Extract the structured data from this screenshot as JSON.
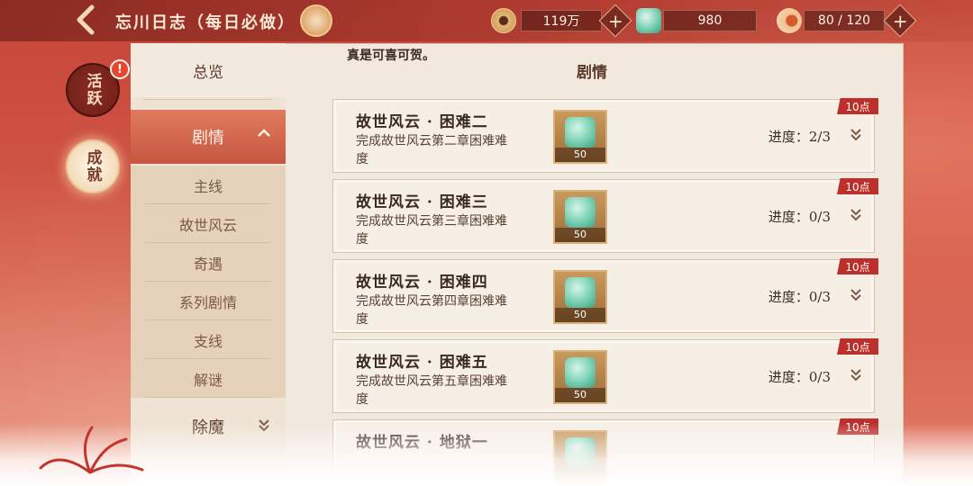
{
  "header": {
    "title": "忘川日志（每日必做）",
    "currency": "119万",
    "jade": "980",
    "stamina": "80 / 120"
  },
  "side_tabs": {
    "active_label": "活跃",
    "achieve_label": "成就",
    "alert": "!"
  },
  "banner_text": "真是可喜可贺。",
  "nav": {
    "overview": "总览",
    "story": "剧情",
    "sub_items": [
      "主线",
      "故世风云",
      "奇遇",
      "系列剧情",
      "支线",
      "解谜"
    ],
    "exorcise": "除魔"
  },
  "section_title": "剧情",
  "quests": [
    {
      "title": "故世风云 · 困难二",
      "desc": "完成故世风云第二章困难难度",
      "reward": "50",
      "progress": "进度：2/3",
      "points": "10点"
    },
    {
      "title": "故世风云 · 困难三",
      "desc": "完成故世风云第三章困难难度",
      "reward": "50",
      "progress": "进度：0/3",
      "points": "10点"
    },
    {
      "title": "故世风云 · 困难四",
      "desc": "完成故世风云第四章困难难度",
      "reward": "50",
      "progress": "进度：0/3",
      "points": "10点"
    },
    {
      "title": "故世风云 · 困难五",
      "desc": "完成故世风云第五章困难难度",
      "reward": "50",
      "progress": "进度：0/3",
      "points": "10点"
    },
    {
      "title": "故世风云 · 地狱一",
      "desc": "",
      "reward": "",
      "progress": "",
      "points": "10点"
    }
  ],
  "icons": {
    "back": "back-arrow-icon",
    "badge": "gift-icon",
    "currency": "coin-icon",
    "jade": "jade-icon",
    "stamina": "stamina-icon",
    "expand": "double-chevron-down-icon",
    "collapse": "chevron-up-icon"
  },
  "colors": {
    "accent": "#c65640",
    "tag": "#bd2f2a",
    "panel": "#f1e8de"
  }
}
